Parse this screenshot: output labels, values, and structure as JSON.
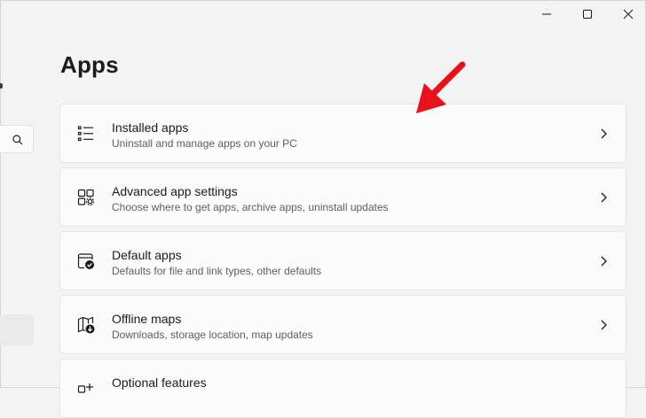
{
  "page": {
    "title": "Apps"
  },
  "titlebar": {
    "minimize_icon": "minimize-icon",
    "maximize_icon": "maximize-icon",
    "close_icon": "close-icon"
  },
  "sidebar": {
    "search_icon": "search-icon"
  },
  "cards": [
    {
      "icon": "list-icon",
      "title": "Installed apps",
      "subtitle": "Uninstall and manage apps on your PC"
    },
    {
      "icon": "app-settings-icon",
      "title": "Advanced app settings",
      "subtitle": "Choose where to get apps, archive apps, uninstall updates"
    },
    {
      "icon": "default-apps-icon",
      "title": "Default apps",
      "subtitle": "Defaults for file and link types, other defaults"
    },
    {
      "icon": "offline-maps-icon",
      "title": "Offline maps",
      "subtitle": "Downloads, storage location, map updates"
    },
    {
      "icon": "optional-features-icon",
      "title": "Optional features",
      "subtitle": ""
    }
  ],
  "annotation": {
    "arrow_color": "#e8101b"
  },
  "colors": {
    "background": "#f3f3f3",
    "card": "#fbfbfb",
    "accent_arrow": "#e8101b"
  }
}
